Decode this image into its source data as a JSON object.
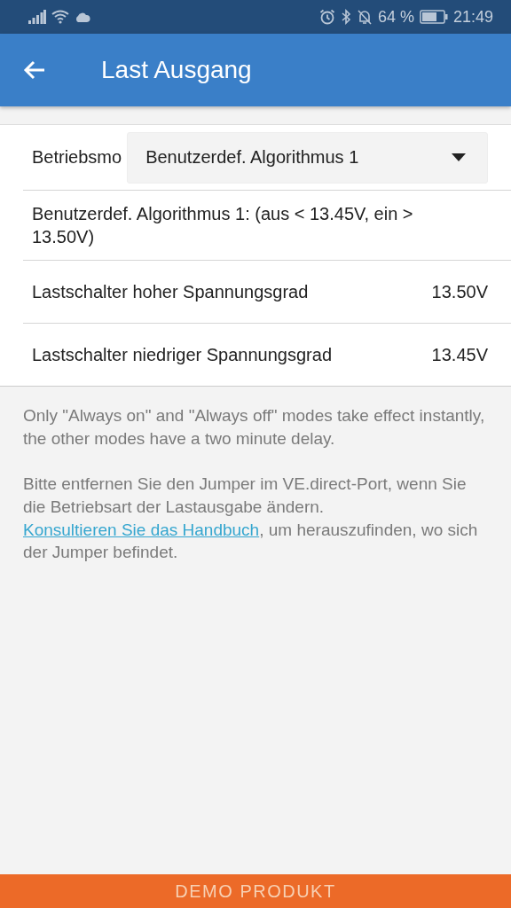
{
  "status_bar": {
    "battery_percent": "64 %",
    "time": "21:49"
  },
  "app_bar": {
    "title": "Last Ausgang"
  },
  "mode": {
    "label": "Betriebsmo",
    "value": "Benutzerdef. Algorithmus 1"
  },
  "description": "Benutzerdef. Algorithmus 1: (aus < 13.45V, ein > 13.50V)",
  "settings": [
    {
      "label": "Lastschalter hoher Spannungsgrad",
      "value": "13.50V"
    },
    {
      "label": "Lastschalter niedriger Spannungsgrad",
      "value": "13.45V"
    }
  ],
  "notes": {
    "delay_note": "Only \"Always on\" and \"Always off\" modes take effect instantly, the other modes have a two minute delay.",
    "jumper_before": "Bitte entfernen Sie den Jumper im VE.direct-Port, wenn Sie die Betriebsart der Lastausgabe ändern.",
    "manual_link": "Konsultieren Sie das Handbuch",
    "jumper_after": ", um herauszufinden, wo sich der Jumper befindet."
  },
  "footer": {
    "label": "DEMO PRODUKT"
  }
}
